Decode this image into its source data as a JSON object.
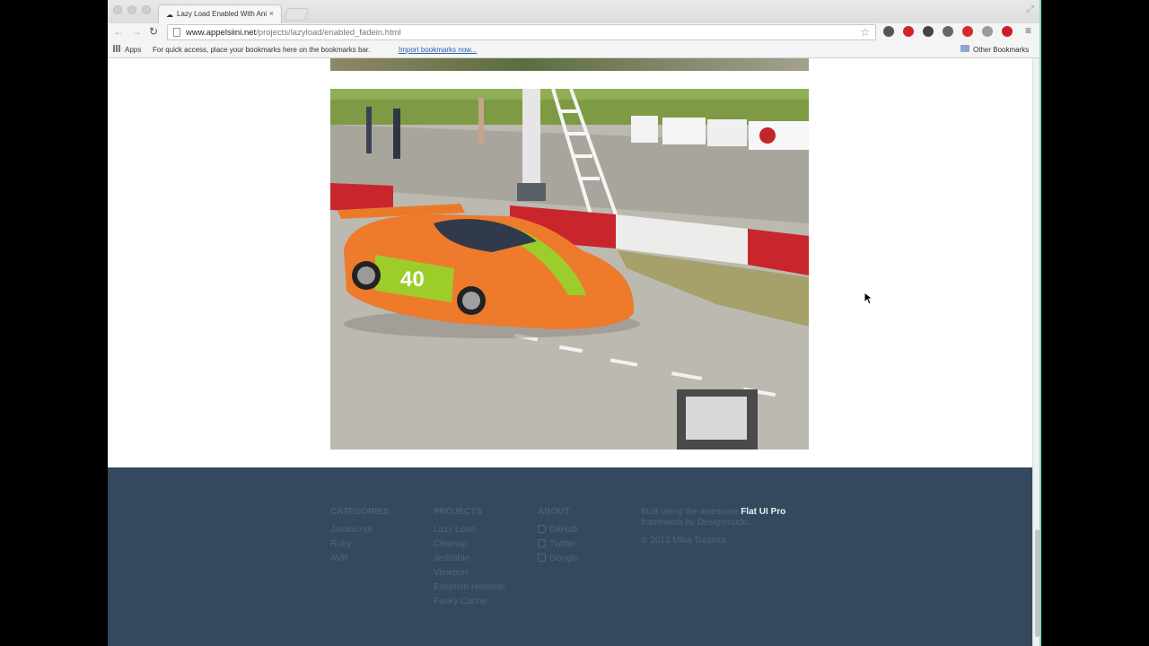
{
  "browser": {
    "tab_title": "Lazy Load Enabled With Animation",
    "tab_close": "×",
    "url_host": "www.appelsiini.net",
    "url_path": "/projects/lazyload/enabled_fadein.html"
  },
  "bookmarks_bar": {
    "apps": "Apps",
    "hint": "For quick access, place your bookmarks here on the bookmarks bar.",
    "import": "Import bookmarks now...",
    "other": "Other Bookmarks"
  },
  "extensions": [
    {
      "name": "evernote-icon",
      "color": "#555555"
    },
    {
      "name": "opera-icon",
      "color": "#d0232b"
    },
    {
      "name": "chrome-icon",
      "color": "#444444"
    },
    {
      "name": "wrench-icon",
      "color": "#666666"
    },
    {
      "name": "adblock-icon",
      "color": "#d22c2c"
    },
    {
      "name": "extension-icon",
      "color": "#9a9a9a"
    },
    {
      "name": "pinterest-icon",
      "color": "#cb2027"
    }
  ],
  "photo": {
    "race_number": "40",
    "colors": {
      "body": "#ee7a2c",
      "stripe": "#9ccd2a",
      "track": "#b9b6ae",
      "grass": "#7e9a44"
    }
  },
  "footer": {
    "categories": {
      "title": "CATEGORIES",
      "links": [
        "JavaScript",
        "Ruby",
        "AVR"
      ]
    },
    "projects": {
      "title": "PROJECTS",
      "links": [
        "Lazy Load",
        "Cleanup",
        "Jeditable",
        "Viewport",
        "Exeption Helmetic",
        "Funky Cache"
      ]
    },
    "about": {
      "title": "ABOUT",
      "links": [
        "GitHub",
        "Twitter",
        "Google"
      ]
    },
    "credits": {
      "line1": "Built using the awesome",
      "brand": "Flat UI Pro",
      "line2": "framework by Designmodo.",
      "copyright": "© 2013 Mika Tuupola"
    },
    "colors": {
      "background": "#34495e",
      "muted": "#4f6579",
      "bright": "#e8eef3"
    }
  }
}
